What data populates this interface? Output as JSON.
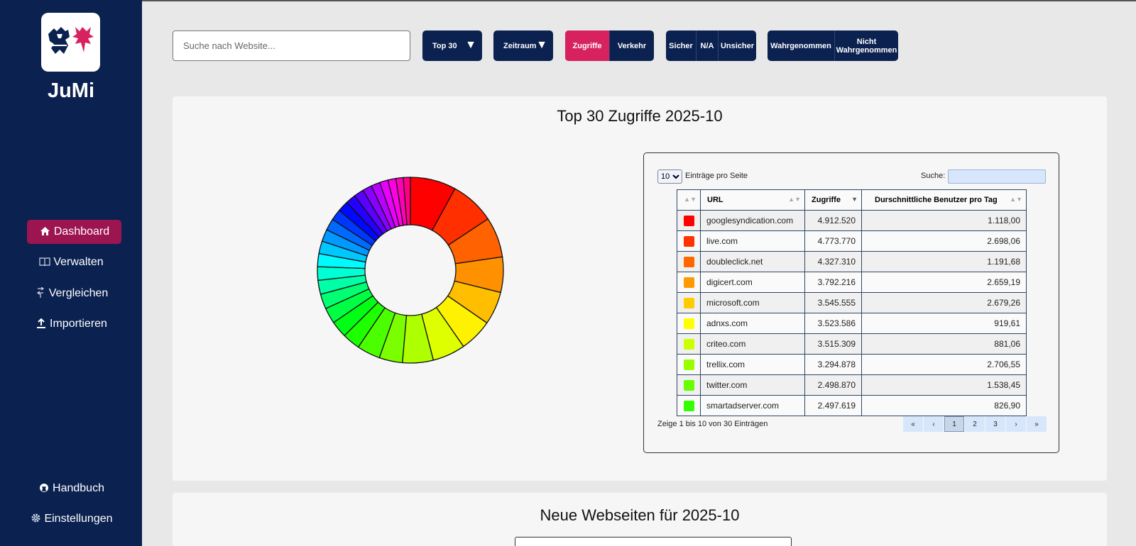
{
  "sidebar": {
    "app_name": "JuMi",
    "logo_icon": "coat-of-arms-logo",
    "items": [
      {
        "label": "Dashboard",
        "icon": "home-icon",
        "active": true
      },
      {
        "label": "Verwalten",
        "icon": "book-icon"
      },
      {
        "label": "Vergleichen",
        "icon": "compare-arrows-icon"
      },
      {
        "label": "Importieren",
        "icon": "upload-icon"
      }
    ],
    "bottom_items": [
      {
        "label": "Handbuch",
        "icon": "github-icon"
      },
      {
        "label": "Einstellungen",
        "icon": "gear-icon"
      }
    ]
  },
  "toolbar": {
    "search_placeholder": "Suche nach Website...",
    "top_dropdown": "Top 30",
    "period_dropdown": "Zeitraum",
    "metric_toggle": [
      "Zugriffe",
      "Verkehr"
    ],
    "metric_active": "Zugriffe",
    "safety_toggle": [
      "Sicher",
      "N/A",
      "Unsicher"
    ],
    "perception_toggle": [
      "Wahrgenommen",
      "Nicht Wahrgenommen"
    ]
  },
  "panel1": {
    "title": "Top 30 Zugriffe 2025-10",
    "table": {
      "length_value": "10",
      "length_label": "Einträge pro Seite",
      "search_label": "Suche:",
      "columns": [
        "URL",
        "Zugriffe",
        "Durschnittliche Benutzer pro Tag"
      ],
      "rows": [
        {
          "color": "#ff0000",
          "url": "googlesyndication.com",
          "hits": "4.912.520",
          "avg": "1.118,00"
        },
        {
          "color": "#ff3300",
          "url": "live.com",
          "hits": "4.773.770",
          "avg": "2.698,06"
        },
        {
          "color": "#ff6600",
          "url": "doubleclick.net",
          "hits": "4.327.310",
          "avg": "1.191,68"
        },
        {
          "color": "#ff9900",
          "url": "digicert.com",
          "hits": "3.792.216",
          "avg": "2.659,19"
        },
        {
          "color": "#ffcc00",
          "url": "microsoft.com",
          "hits": "3.545.555",
          "avg": "2.679,26"
        },
        {
          "color": "#ffff00",
          "url": "adnxs.com",
          "hits": "3.523.586",
          "avg": "919,61"
        },
        {
          "color": "#ccff00",
          "url": "criteo.com",
          "hits": "3.515.309",
          "avg": "881,06"
        },
        {
          "color": "#99ff00",
          "url": "trellix.com",
          "hits": "3.294.878",
          "avg": "2.706,55"
        },
        {
          "color": "#66ff00",
          "url": "twitter.com",
          "hits": "2.498.870",
          "avg": "1.538,45"
        },
        {
          "color": "#33ff00",
          "url": "smartadserver.com",
          "hits": "2.497.619",
          "avg": "826,90"
        }
      ],
      "info": "Zeige 1 bis 10 von 30 Einträgen",
      "pager": [
        "«",
        "‹",
        "1",
        "2",
        "3",
        "›",
        "»"
      ],
      "current_page": "1"
    }
  },
  "panel2": {
    "title": "Neue Webseiten für 2025-10"
  },
  "chart_data": {
    "type": "pie",
    "donut": true,
    "slices": 30,
    "labels": [
      "googlesyndication.com",
      "live.com",
      "doubleclick.net",
      "digicert.com",
      "microsoft.com",
      "adnxs.com",
      "criteo.com",
      "trellix.com",
      "twitter.com",
      "smartadserver.com"
    ],
    "values": [
      4912520,
      4773770,
      4327310,
      3792216,
      3545555,
      3523586,
      3515309,
      3294878,
      2498870,
      2497619,
      1900000,
      1800000,
      1700000,
      1600000,
      1500000,
      1450000,
      1400000,
      1350000,
      1300000,
      1250000,
      1200000,
      1150000,
      1100000,
      1050000,
      1000000,
      950000,
      900000,
      850000,
      800000,
      750000
    ]
  }
}
